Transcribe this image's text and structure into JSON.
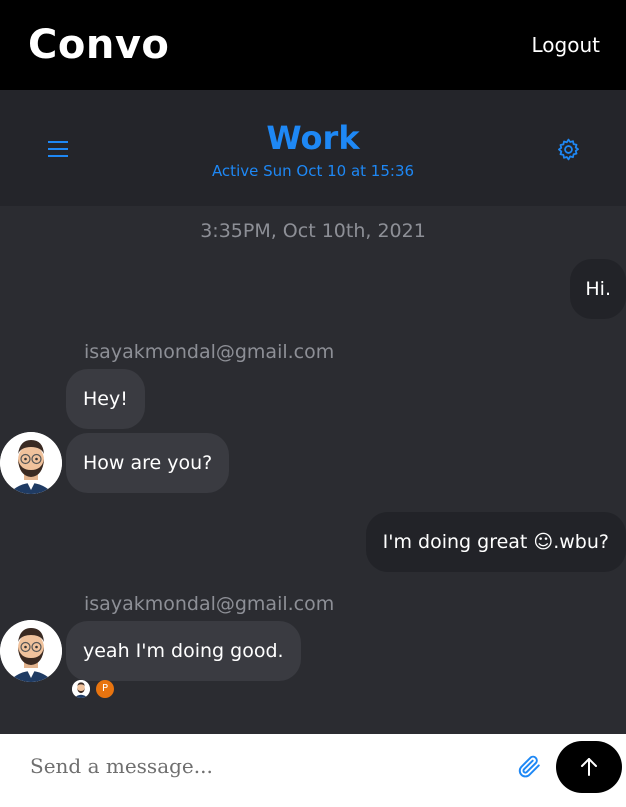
{
  "app": {
    "brand": "Convo",
    "logout_label": "Logout"
  },
  "chat": {
    "title": "Work",
    "status": "Active Sun Oct 10 at 15:36",
    "date_separator": "3:35PM, Oct 10th, 2021"
  },
  "messages": [
    {
      "direction": "outgoing",
      "text": "Hi."
    },
    {
      "direction": "incoming",
      "sender": "isayakmondal@gmail.com",
      "text": "Hey!"
    },
    {
      "direction": "incoming",
      "text": "How are you?"
    },
    {
      "direction": "outgoing",
      "text": "I'm doing great ☺.wbu?"
    },
    {
      "direction": "incoming",
      "sender": "isayakmondal@gmail.com",
      "text": "yeah I'm doing good."
    }
  ],
  "read_receipts": {
    "badge_letter": "P",
    "badge_color": "#e8740f"
  },
  "composer": {
    "placeholder": "Send a message..."
  },
  "colors": {
    "accent": "#1e88f5",
    "topbar": "#000000",
    "background": "#2b2c31",
    "bubble_incoming": "#3a3b41",
    "bubble_outgoing": "#222328"
  },
  "icons": {
    "menu": "hamburger-menu-icon",
    "settings": "gear-icon",
    "attach": "paperclip-icon",
    "send": "arrow-up-icon"
  }
}
